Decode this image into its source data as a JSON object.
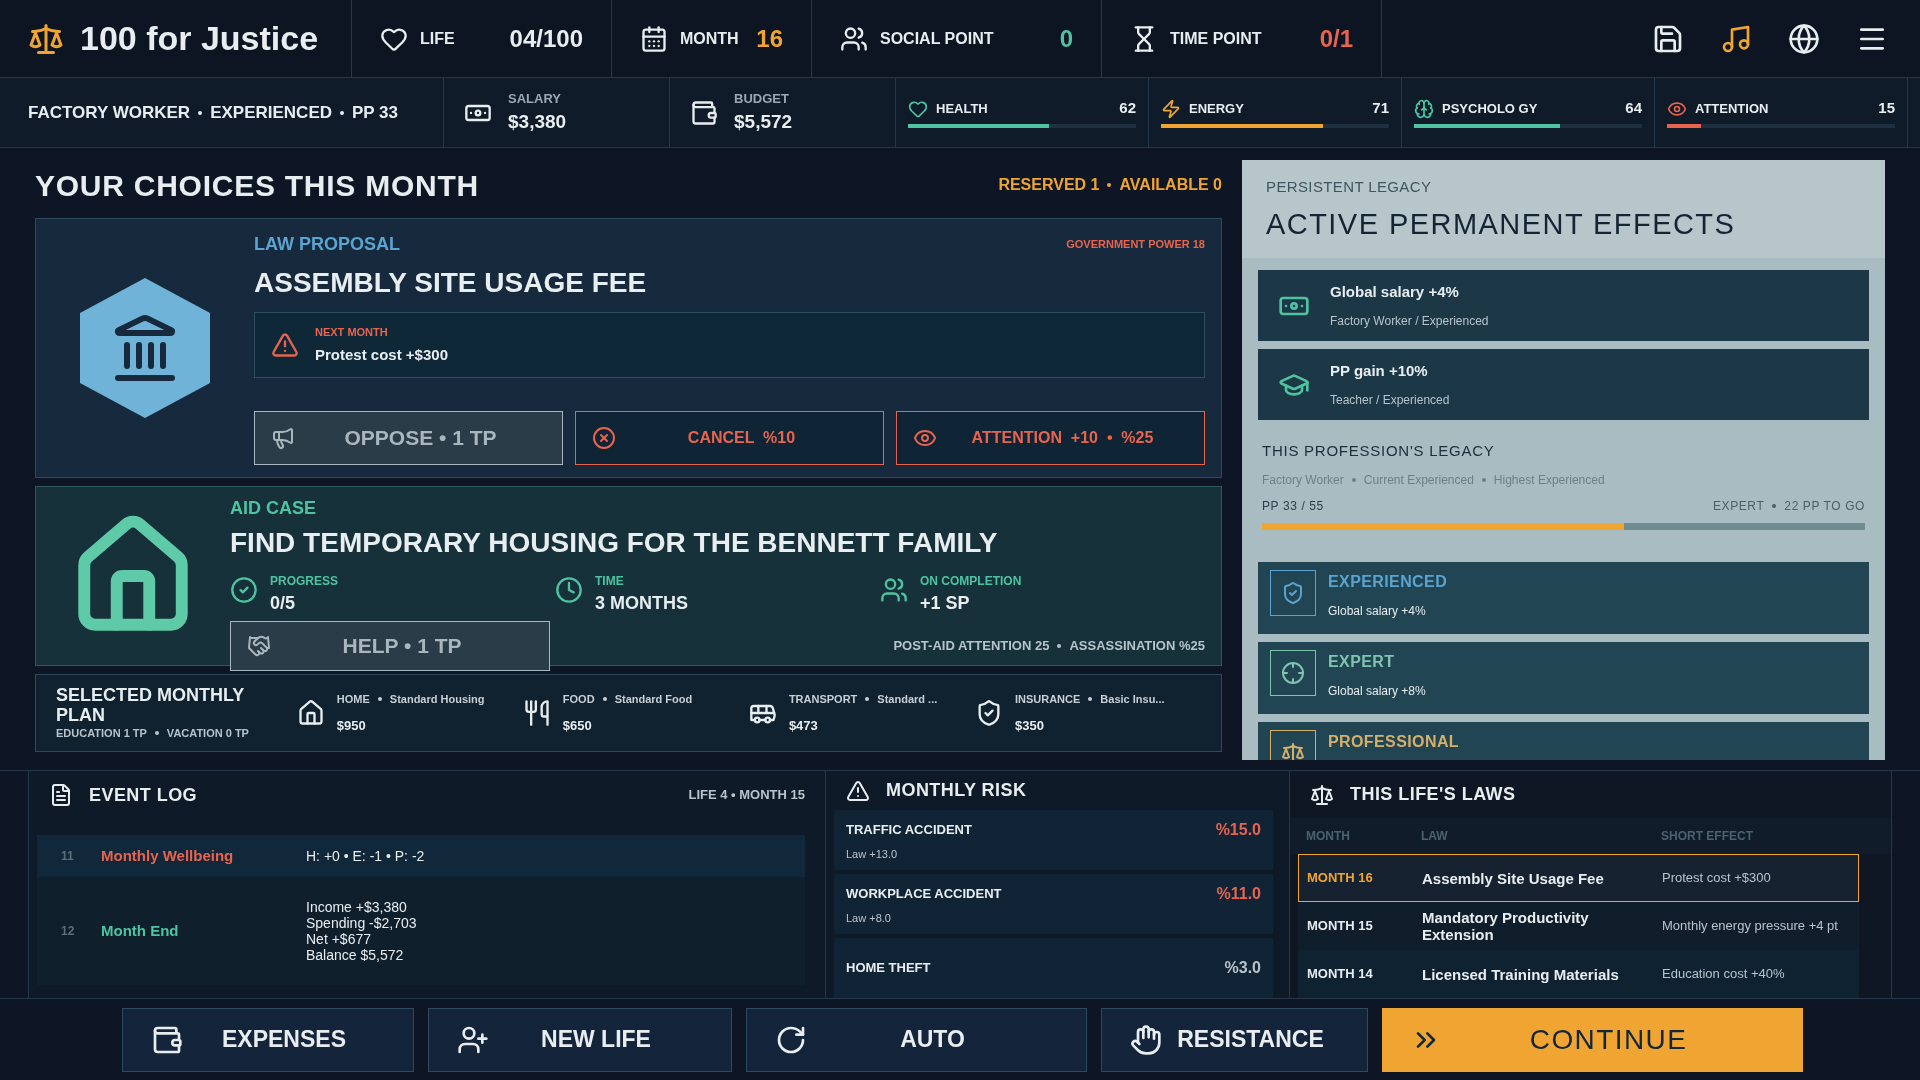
{
  "header": {
    "title": "100 for Justice",
    "stats": [
      {
        "label": "LIFE",
        "value": "04/100",
        "color": "#e8edf0"
      },
      {
        "label": "MONTH",
        "value": "16",
        "color": "#f0a532"
      },
      {
        "label": "SOCIAL POINT",
        "value": "0",
        "color": "#4fc3a1"
      },
      {
        "label": "TIME POINT",
        "value": "0/1",
        "color": "#e8644f"
      }
    ]
  },
  "status": {
    "profession": [
      "FACTORY WORKER",
      "EXPERIENCED",
      "PP 33"
    ],
    "money": [
      {
        "label": "SALARY",
        "value": "$3,380"
      },
      {
        "label": "BUDGET",
        "value": "$5,572"
      }
    ],
    "meters": [
      {
        "label": "HEALTH",
        "value": "62",
        "level": 0.62,
        "color": "#4fc3a1"
      },
      {
        "label": "ENERGY",
        "value": "71",
        "level": 0.71,
        "color": "#f0a532"
      },
      {
        "label": "PSYCHOLO GY",
        "value": "64",
        "level": 0.64,
        "color": "#4fc3a1"
      },
      {
        "label": "ATTENTION",
        "value": "15",
        "level": 0.15,
        "color": "#e8644f"
      }
    ]
  },
  "choices": {
    "title": "YOUR CHOICES THIS MONTH",
    "counters": [
      "RESERVED 1",
      "AVAILABLE 0"
    ],
    "law": {
      "category": "LAW PROPOSAL",
      "title": "ASSEMBLY SITE USAGE FEE",
      "power": "GOVERNMENT POWER 18",
      "notice": {
        "label": "NEXT MONTH",
        "text": "Protest cost +$300"
      },
      "actions": [
        {
          "kind": "primary",
          "label": "OPPOSE • 1 TP"
        },
        {
          "kind": "danger",
          "label": "CANCEL  %10"
        },
        {
          "kind": "danger",
          "label": "ATTENTION  +10  •  %25"
        }
      ]
    },
    "aid": {
      "category": "AID CASE",
      "title": "FIND TEMPORARY HOUSING FOR THE BENNETT FAMILY",
      "facts": [
        {
          "label": "PROGRESS",
          "value": "0/5"
        },
        {
          "label": "TIME",
          "value": "3 MONTHS"
        },
        {
          "label": "ON COMPLETION",
          "value": "+1 SP"
        }
      ],
      "action": "HELP • 1 TP",
      "footer": [
        "POST-AID ATTENTION 25",
        "ASSASSINATION %25"
      ]
    },
    "plan": {
      "title": "SELECTED MONTHLY PLAN",
      "sub": [
        "EDUCATION 1 TP",
        "VACATION 0 TP"
      ],
      "items": [
        {
          "category": "HOME",
          "name": "Standard Housing",
          "cost": "$950"
        },
        {
          "category": "FOOD",
          "name": "Standard Food",
          "cost": "$650"
        },
        {
          "category": "TRANSPORT",
          "name": "Standard ...",
          "cost": "$473"
        },
        {
          "category": "INSURANCE",
          "name": "Basic Insu...",
          "cost": "$350"
        }
      ]
    }
  },
  "legacy": {
    "eyebrow": "PERSISTENT LEGACY",
    "title": "ACTIVE PERMANENT EFFECTS",
    "effects": [
      {
        "title": "Global salary +4%",
        "sub": "Factory Worker / Experienced"
      },
      {
        "title": "PP gain +10%",
        "sub": "Teacher / Experienced"
      }
    ],
    "section": "THIS PROFESSION'S LEGACY",
    "meta": [
      "Factory Worker",
      "Current Experienced",
      "Highest Experienced"
    ],
    "pp": "PP 33 / 55",
    "next": [
      "EXPERT",
      "22 PP TO GO"
    ],
    "level": 0.6,
    "tiers": [
      {
        "name": "EXPERIENCED",
        "desc": "Global salary +4%",
        "color": "#5ba3d0"
      },
      {
        "name": "EXPERT",
        "desc": "Global salary +8%",
        "color": "#7fc4ae"
      },
      {
        "name": "PROFESSIONAL",
        "color": "#d4b06a"
      }
    ]
  },
  "event_log": {
    "title": "EVENT LOG",
    "meta": "LIFE 4 • MONTH 15",
    "rows": [
      {
        "index": "11",
        "title": "Monthly Wellbeing",
        "color": "#e8644f",
        "lines": [
          "H: +0 • E: -1 • P: -2"
        ]
      },
      {
        "index": "12",
        "title": "Month End",
        "color": "#4fc3a1",
        "lines": [
          "Income +$3,380",
          "Spending -$2,703",
          "Net +$677",
          "Balance $5,572"
        ]
      }
    ]
  },
  "risk": {
    "title": "MONTHLY RISK",
    "rows": [
      {
        "name": "TRAFFIC ACCIDENT",
        "detail": "Law +13.0",
        "value": "%15.0",
        "color": "#e8644f"
      },
      {
        "name": "WORKPLACE ACCIDENT",
        "detail": "Law +8.0",
        "value": "%11.0",
        "color": "#e8644f"
      },
      {
        "name": "HOME THEFT",
        "value": "%3.0",
        "color": "#b8c4cc"
      }
    ]
  },
  "laws": {
    "title": "THIS LIFE'S LAWS",
    "columns": [
      "MONTH",
      "LAW",
      "SHORT EFFECT"
    ],
    "rows": [
      {
        "month": "MONTH 16",
        "law": "Assembly Site Usage Fee",
        "effect": "Protest cost +$300",
        "selected": true
      },
      {
        "month": "MONTH 15",
        "law": "Mandatory Productivity Extension",
        "effect": "Monthly energy pressure +4 pt",
        "selected": false
      },
      {
        "month": "MONTH 14",
        "law": "Licensed Training Materials",
        "effect": "Education cost +40%",
        "selected": false
      }
    ]
  },
  "footer": [
    {
      "label": "EXPENSES",
      "kind": "normal"
    },
    {
      "label": "NEW LIFE",
      "kind": "normal"
    },
    {
      "label": "AUTO",
      "kind": "normal"
    },
    {
      "label": "RESISTANCE",
      "kind": "normal"
    },
    {
      "label": "CONTINUE",
      "kind": "primary"
    }
  ]
}
